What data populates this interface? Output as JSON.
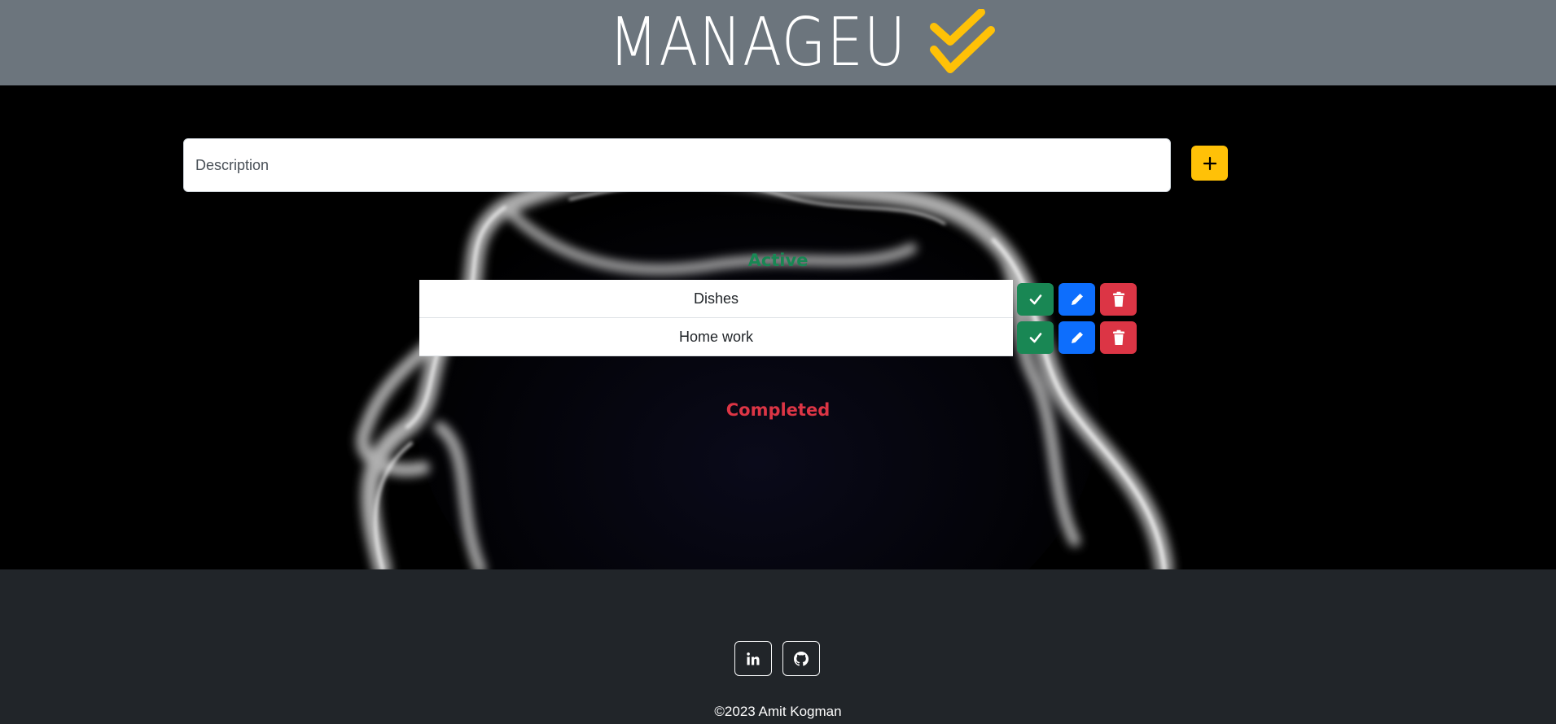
{
  "header": {
    "brand_text": "MANAGEU",
    "logo_icon": "double-check-icon",
    "logo_color": "#ffc107",
    "background": "#6c757d"
  },
  "task_form": {
    "description_placeholder": "Description",
    "description_value": "",
    "add_icon": "plus-icon"
  },
  "sections": {
    "active_title": "Active",
    "completed_title": "Completed"
  },
  "active_tasks": [
    {
      "label": "Dishes"
    },
    {
      "label": "Home work"
    }
  ],
  "task_actions": {
    "complete_icon": "check-icon",
    "edit_icon": "pencil-icon",
    "delete_icon": "trash-icon"
  },
  "colors": {
    "success": "#198754",
    "primary": "#0d6efd",
    "danger": "#dc3545",
    "warning": "#ffc107",
    "footer": "#212529"
  },
  "footer": {
    "social": [
      "linkedin-icon",
      "github-icon"
    ],
    "copyright": "©2023 Amit Kogman"
  }
}
